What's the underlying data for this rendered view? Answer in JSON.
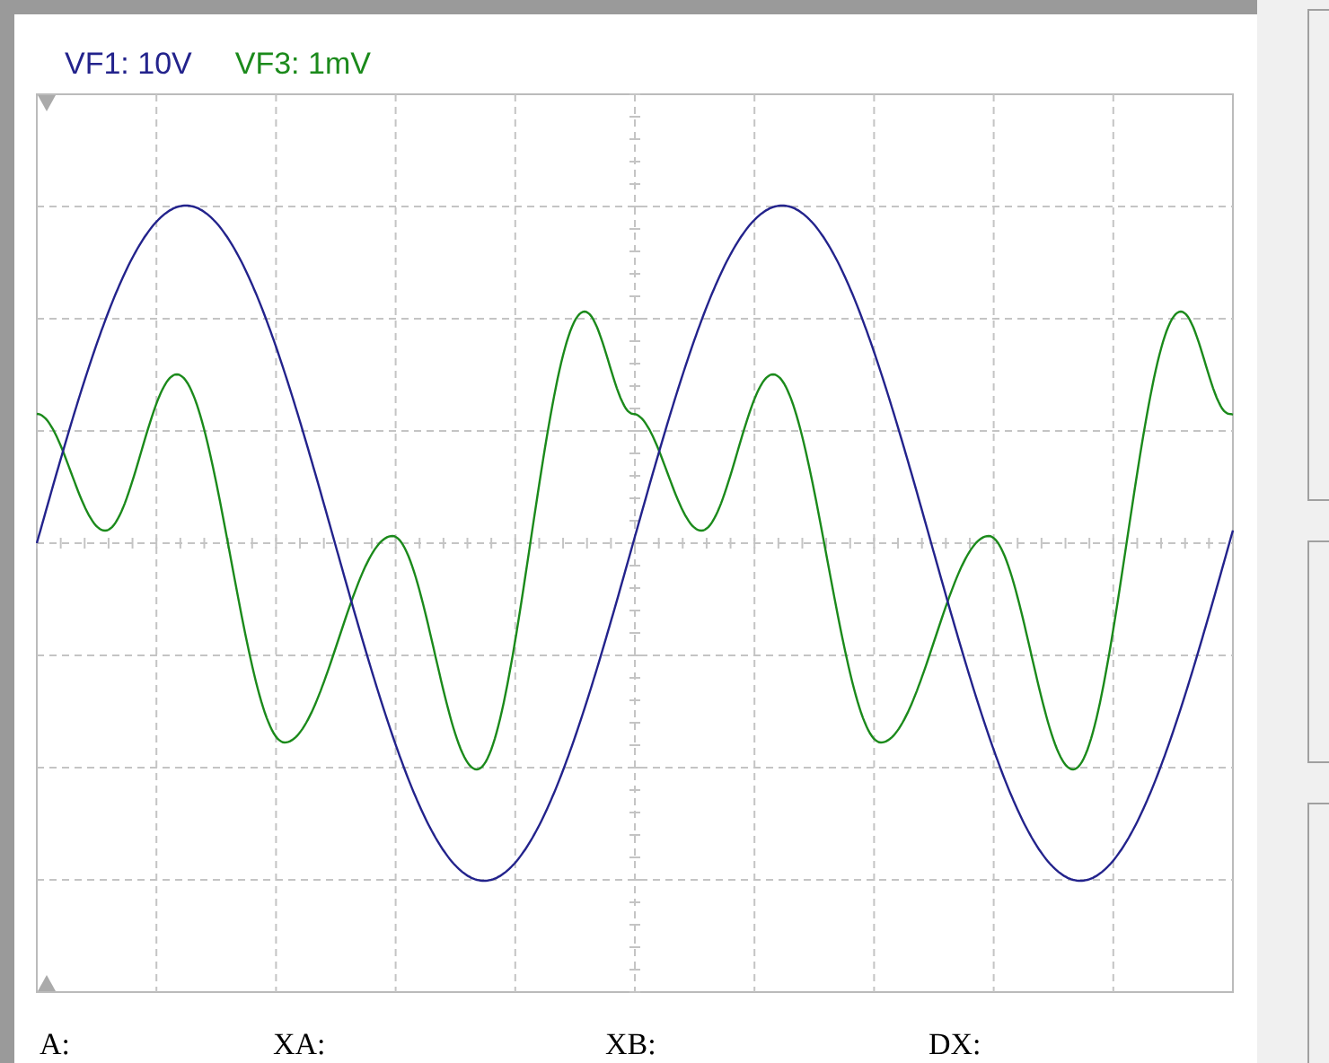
{
  "channels": [
    {
      "label": "VF1: 10V",
      "color": "#23238c"
    },
    {
      "label": "VF3: 1mV",
      "color": "#1b8a1b"
    }
  ],
  "readouts": [
    "A:",
    "XA:",
    "XB:",
    "DX:"
  ]
}
